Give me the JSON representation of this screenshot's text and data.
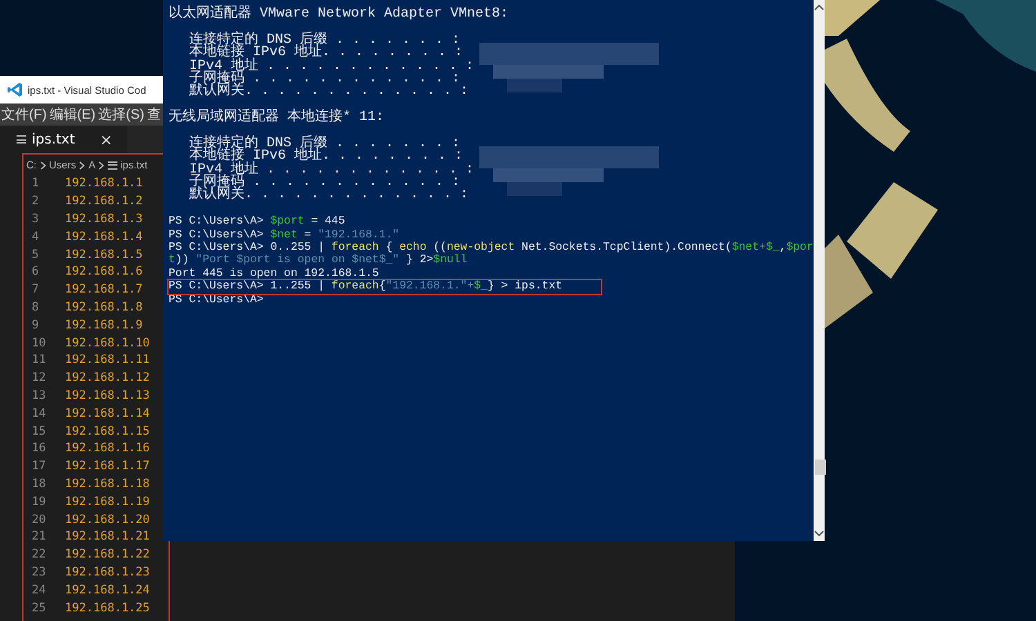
{
  "vscode": {
    "title": "ips.txt - Visual Studio Cod",
    "menu": [
      "文件(F)",
      "编辑(E)",
      "选择(S)",
      "查"
    ],
    "tab": {
      "label": "ips.txt",
      "close": "×"
    },
    "breadcrumb": [
      "C:",
      "Users",
      "A",
      "ips.txt"
    ],
    "highlighted": true,
    "lines": [
      {
        "number": "1",
        "text": "192.168.1.1"
      },
      {
        "number": "2",
        "text": "192.168.1.2"
      },
      {
        "number": "3",
        "text": "192.168.1.3"
      },
      {
        "number": "4",
        "text": "192.168.1.4"
      },
      {
        "number": "5",
        "text": "192.168.1.5"
      },
      {
        "number": "6",
        "text": "192.168.1.6"
      },
      {
        "number": "7",
        "text": "192.168.1.7"
      },
      {
        "number": "8",
        "text": "192.168.1.8"
      },
      {
        "number": "9",
        "text": "192.168.1.9"
      },
      {
        "number": "10",
        "text": "192.168.1.10"
      },
      {
        "number": "11",
        "text": "192.168.1.11"
      },
      {
        "number": "12",
        "text": "192.168.1.12"
      },
      {
        "number": "13",
        "text": "192.168.1.13"
      },
      {
        "number": "14",
        "text": "192.168.1.14"
      },
      {
        "number": "15",
        "text": "192.168.1.15"
      },
      {
        "number": "16",
        "text": "192.168.1.16"
      },
      {
        "number": "17",
        "text": "192.168.1.17"
      },
      {
        "number": "18",
        "text": "192.168.1.18"
      },
      {
        "number": "19",
        "text": "192.168.1.19"
      },
      {
        "number": "20",
        "text": "192.168.1.20"
      },
      {
        "number": "21",
        "text": "192.168.1.21"
      },
      {
        "number": "22",
        "text": "192.168.1.22"
      },
      {
        "number": "23",
        "text": "192.168.1.23"
      },
      {
        "number": "24",
        "text": "192.168.1.24"
      },
      {
        "number": "25",
        "text": "192.168.1.25"
      }
    ]
  },
  "console": {
    "ipconfig": [
      {
        "heading": "以太网适配器 VMware Network Adapter VMnet8:",
        "entries": [
          "连接特定的 DNS 后缀 . . . . . . . :",
          "本地链接 IPv6 地址. . . . . . . . :",
          "IPv4 地址 . . . . . . . . . . . . :",
          "子网掩码 . . . . . . . . . . . . :",
          "默认网关. . . . . . . . . . . . . :"
        ]
      },
      {
        "heading": "无线局域网适配器 本地连接* 11:",
        "entries": [
          "连接特定的 DNS 后缀 . . . . . . . :",
          "本地链接 IPv6 地址. . . . . . . . :",
          "IPv4 地址 . . . . . . . . . . . . :",
          "子网掩码 . . . . . . . . . . . . :",
          "默认网关. . . . . . . . . . . . . :"
        ]
      }
    ],
    "lines": [
      {
        "highlighted": false,
        "segments": [
          {
            "text": "PS C:\\Users\\A> ",
            "kind": "plain"
          },
          {
            "text": "$port",
            "kind": "variable"
          },
          {
            "text": " = 445",
            "kind": "plain"
          }
        ]
      },
      {
        "highlighted": false,
        "segments": [
          {
            "text": "PS C:\\Users\\A> ",
            "kind": "plain"
          },
          {
            "text": "$net",
            "kind": "variable"
          },
          {
            "text": " = ",
            "kind": "plain"
          },
          {
            "text": "\"192.168.1.\"",
            "kind": "string"
          }
        ]
      },
      {
        "highlighted": false,
        "segments": [
          {
            "text": "PS C:\\Users\\A> 0..255 | ",
            "kind": "plain"
          },
          {
            "text": "foreach",
            "kind": "command"
          },
          {
            "text": " { ",
            "kind": "plain"
          },
          {
            "text": "echo",
            "kind": "command"
          },
          {
            "text": " ((",
            "kind": "plain"
          },
          {
            "text": "new-object",
            "kind": "command"
          },
          {
            "text": " Net.Sockets.TcpClient).Connect(",
            "kind": "plain"
          },
          {
            "text": "$net",
            "kind": "variable"
          },
          {
            "text": "+",
            "kind": "operator"
          },
          {
            "text": "$_",
            "kind": "variable"
          },
          {
            "text": ",",
            "kind": "plain"
          },
          {
            "text": "$por",
            "kind": "variable"
          }
        ]
      },
      {
        "highlighted": false,
        "segments": [
          {
            "text": "t",
            "kind": "variable"
          },
          {
            "text": ")) ",
            "kind": "plain"
          },
          {
            "text": "\"Port $port is open on $net$_\"",
            "kind": "string"
          },
          {
            "text": " } 2>",
            "kind": "plain"
          },
          {
            "text": "$null",
            "kind": "variable"
          }
        ]
      },
      {
        "highlighted": false,
        "segments": [
          {
            "text": "Port 445 is open on 192.168.1.5",
            "kind": "plain"
          }
        ]
      },
      {
        "highlighted": true,
        "segments": [
          {
            "text": "PS C:\\Users\\A> 1..255 | ",
            "kind": "plain"
          },
          {
            "text": "foreach",
            "kind": "command"
          },
          {
            "text": "{",
            "kind": "plain"
          },
          {
            "text": "\"192.168.1.\"",
            "kind": "string"
          },
          {
            "text": "+",
            "kind": "operator"
          },
          {
            "text": "$_",
            "kind": "variable"
          },
          {
            "text": "} > ips.txt",
            "kind": "plain"
          }
        ]
      },
      {
        "highlighted": false,
        "segments": [
          {
            "text": "PS C:\\Users\\A>",
            "kind": "plain"
          }
        ]
      }
    ]
  }
}
